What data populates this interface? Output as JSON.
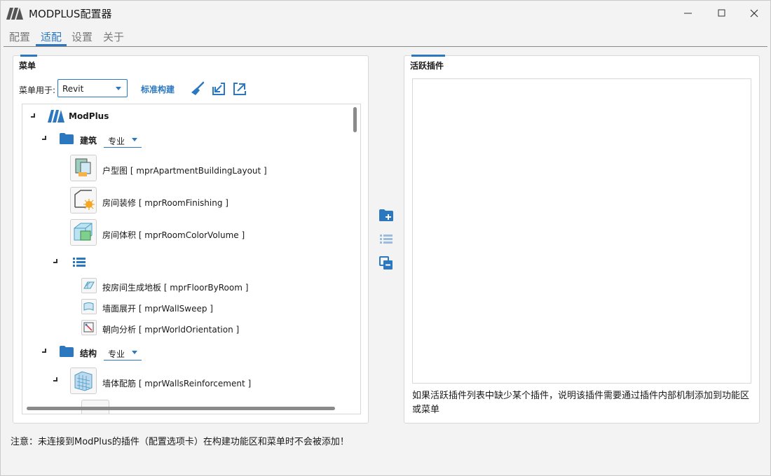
{
  "app": {
    "title": "MODPLUS配置器"
  },
  "tabs": [
    {
      "label": "配置"
    },
    {
      "label": "适配"
    },
    {
      "label": "设置"
    },
    {
      "label": "关于"
    }
  ],
  "menu_panel": {
    "title": "菜单",
    "menu_for_label": "菜单用于:",
    "menu_for_value": "Revit",
    "standard_build_link": "标准构建",
    "tree": {
      "root": "ModPlus",
      "groups": [
        {
          "name": "建筑",
          "mode": "专业",
          "items": [
            {
              "text": "户型图 [ mprApartmentBuildingLayout ]",
              "icon": "apartment-layout-icon"
            },
            {
              "text": "房间装修 [ mprRoomFinishing ]",
              "icon": "room-finishing-icon"
            },
            {
              "text": "房间体积 [ mprRoomColorVolume ]",
              "icon": "room-volume-icon"
            }
          ],
          "subitems": [
            {
              "text": "按房间生成地板 [ mprFloorByRoom ]",
              "icon": "floor-by-room-icon"
            },
            {
              "text": "墙面展开 [ mprWallSweep ]",
              "icon": "wall-sweep-icon"
            },
            {
              "text": "朝向分析 [ mprWorldOrientation ]",
              "icon": "world-orientation-icon"
            }
          ]
        },
        {
          "name": "结构",
          "mode": "专业",
          "items": [
            {
              "text": "墙体配筋 [ mprWallsReinforcement ]",
              "icon": "walls-reinforcement-icon"
            }
          ]
        }
      ]
    }
  },
  "active_panel": {
    "title": "活跃插件",
    "note": "如果活跃插件列表中缺少某个插件，说明该插件需要通过插件内部机制添加到功能区或菜单"
  },
  "footer": {
    "note": "注意：未连接到ModPlus的插件（配置选项卡）在构建功能区和菜单时不会被添加！"
  },
  "colors": {
    "accent": "#2b78c0",
    "window_bg": "#f3f3f3"
  }
}
